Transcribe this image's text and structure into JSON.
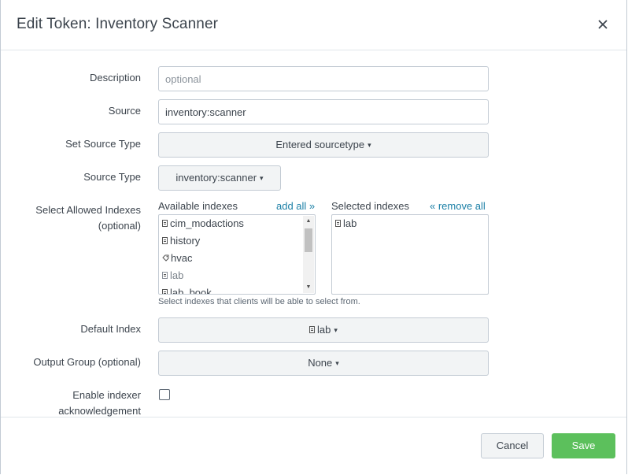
{
  "header": {
    "title": "Edit Token: Inventory Scanner",
    "close_symbol": "×"
  },
  "form": {
    "description": {
      "label": "Description",
      "placeholder": "optional",
      "value": ""
    },
    "source": {
      "label": "Source",
      "value": "inventory:scanner"
    },
    "set_source_type": {
      "label": "Set Source Type",
      "value": "Entered sourcetype",
      "caret": "▾"
    },
    "source_type": {
      "label": "Source Type",
      "value": "inventory:scanner",
      "caret": "▾"
    },
    "indexes": {
      "label_line1": "Select Allowed Indexes",
      "label_line2": "(optional)",
      "available_header": "Available indexes",
      "add_all": "add all »",
      "selected_header": "Selected indexes",
      "remove_all": "« remove all",
      "available": [
        {
          "name": "cim_modactions",
          "icon": "database-icon",
          "disabled": false
        },
        {
          "name": "history",
          "icon": "database-icon",
          "disabled": false
        },
        {
          "name": "hvac",
          "icon": "tag-icon",
          "disabled": false
        },
        {
          "name": "lab",
          "icon": "database-icon",
          "disabled": true
        },
        {
          "name": "lab_book",
          "icon": "database-icon",
          "disabled": false
        }
      ],
      "selected": [
        {
          "name": "lab",
          "icon": "database-icon"
        }
      ],
      "help": "Select indexes that clients will be able to select from."
    },
    "default_index": {
      "label": "Default Index",
      "value": "lab",
      "icon": "database-icon",
      "caret": "▾"
    },
    "output_group": {
      "label": "Output Group (optional)",
      "value": "None",
      "caret": "▾"
    },
    "indexer_ack": {
      "label_line1": "Enable indexer",
      "label_line2": "acknowledgement",
      "checked": false
    }
  },
  "footer": {
    "cancel_label": "Cancel",
    "save_label": "Save"
  },
  "colors": {
    "save_button": "#5cc05c",
    "link": "#1a7fa6",
    "text": "#3c444d",
    "border": "#c3cbd4"
  }
}
